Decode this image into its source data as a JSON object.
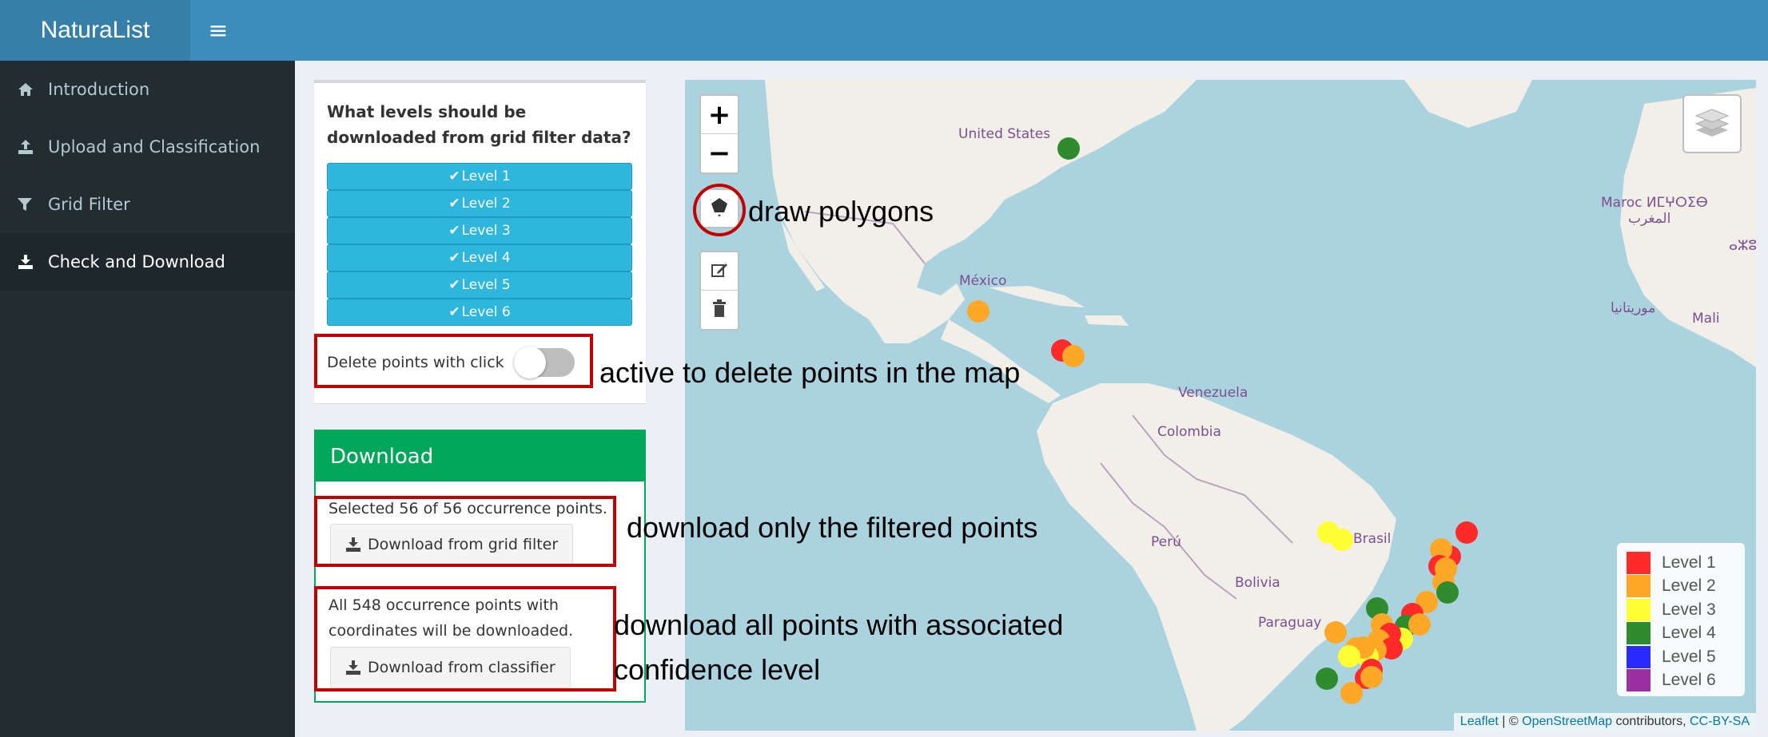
{
  "header": {
    "app_title": "NaturaList",
    "menu_icon": "hamburger-icon"
  },
  "sidebar": {
    "items": [
      {
        "label": "Introduction",
        "icon": "home-icon"
      },
      {
        "label": "Upload and Classification",
        "icon": "upload-icon"
      },
      {
        "label": "Grid Filter",
        "icon": "filter-icon"
      },
      {
        "label": "Check and Download",
        "icon": "download-icon",
        "active": true
      }
    ]
  },
  "levels_box": {
    "question": "What levels should be downloaded from grid filter data?",
    "levels": [
      "Level 1",
      "Level 2",
      "Level 3",
      "Level 4",
      "Level 5",
      "Level 6"
    ],
    "toggle_label": "Delete points with click",
    "toggle_on": false
  },
  "download_box": {
    "title": "Download",
    "selected_text": "Selected 56 of 56 occurrence points.",
    "grid_button": "Download from grid filter",
    "all_text": "All 548 occurrence points with coordinates will be downloaded.",
    "classifier_button": "Download from classifier"
  },
  "annotations": {
    "draw": "draw polygons",
    "delete": "active to delete points in the map",
    "filtered": "download only the filtered points",
    "all_line1": "download all points with associated",
    "all_line2": "confidence level"
  },
  "map": {
    "places": [
      "United States",
      "México",
      "Venezuela",
      "Colombia",
      "Perú",
      "Brasil",
      "Bolivia",
      "Paraguay",
      "Maroc ⵍⵎⵖⵔⵉⴱ",
      "المغرب",
      "ⴰⵣⵓ",
      "موريتانيا",
      "Mali"
    ],
    "legend": [
      {
        "label": "Level 1",
        "color": "#ff2a2a"
      },
      {
        "label": "Level 2",
        "color": "#ffa726"
      },
      {
        "label": "Level 3",
        "color": "#ffff33"
      },
      {
        "label": "Level 4",
        "color": "#2e8b2e"
      },
      {
        "label": "Level 5",
        "color": "#2a2aff"
      },
      {
        "label": "Level 6",
        "color": "#9b30a0"
      }
    ],
    "attribution": {
      "leaflet": "Leaflet",
      "sep": " | © ",
      "osm": "OpenStreetMap",
      "contrib": " contributors, ",
      "license": "CC-BY-SA"
    }
  }
}
